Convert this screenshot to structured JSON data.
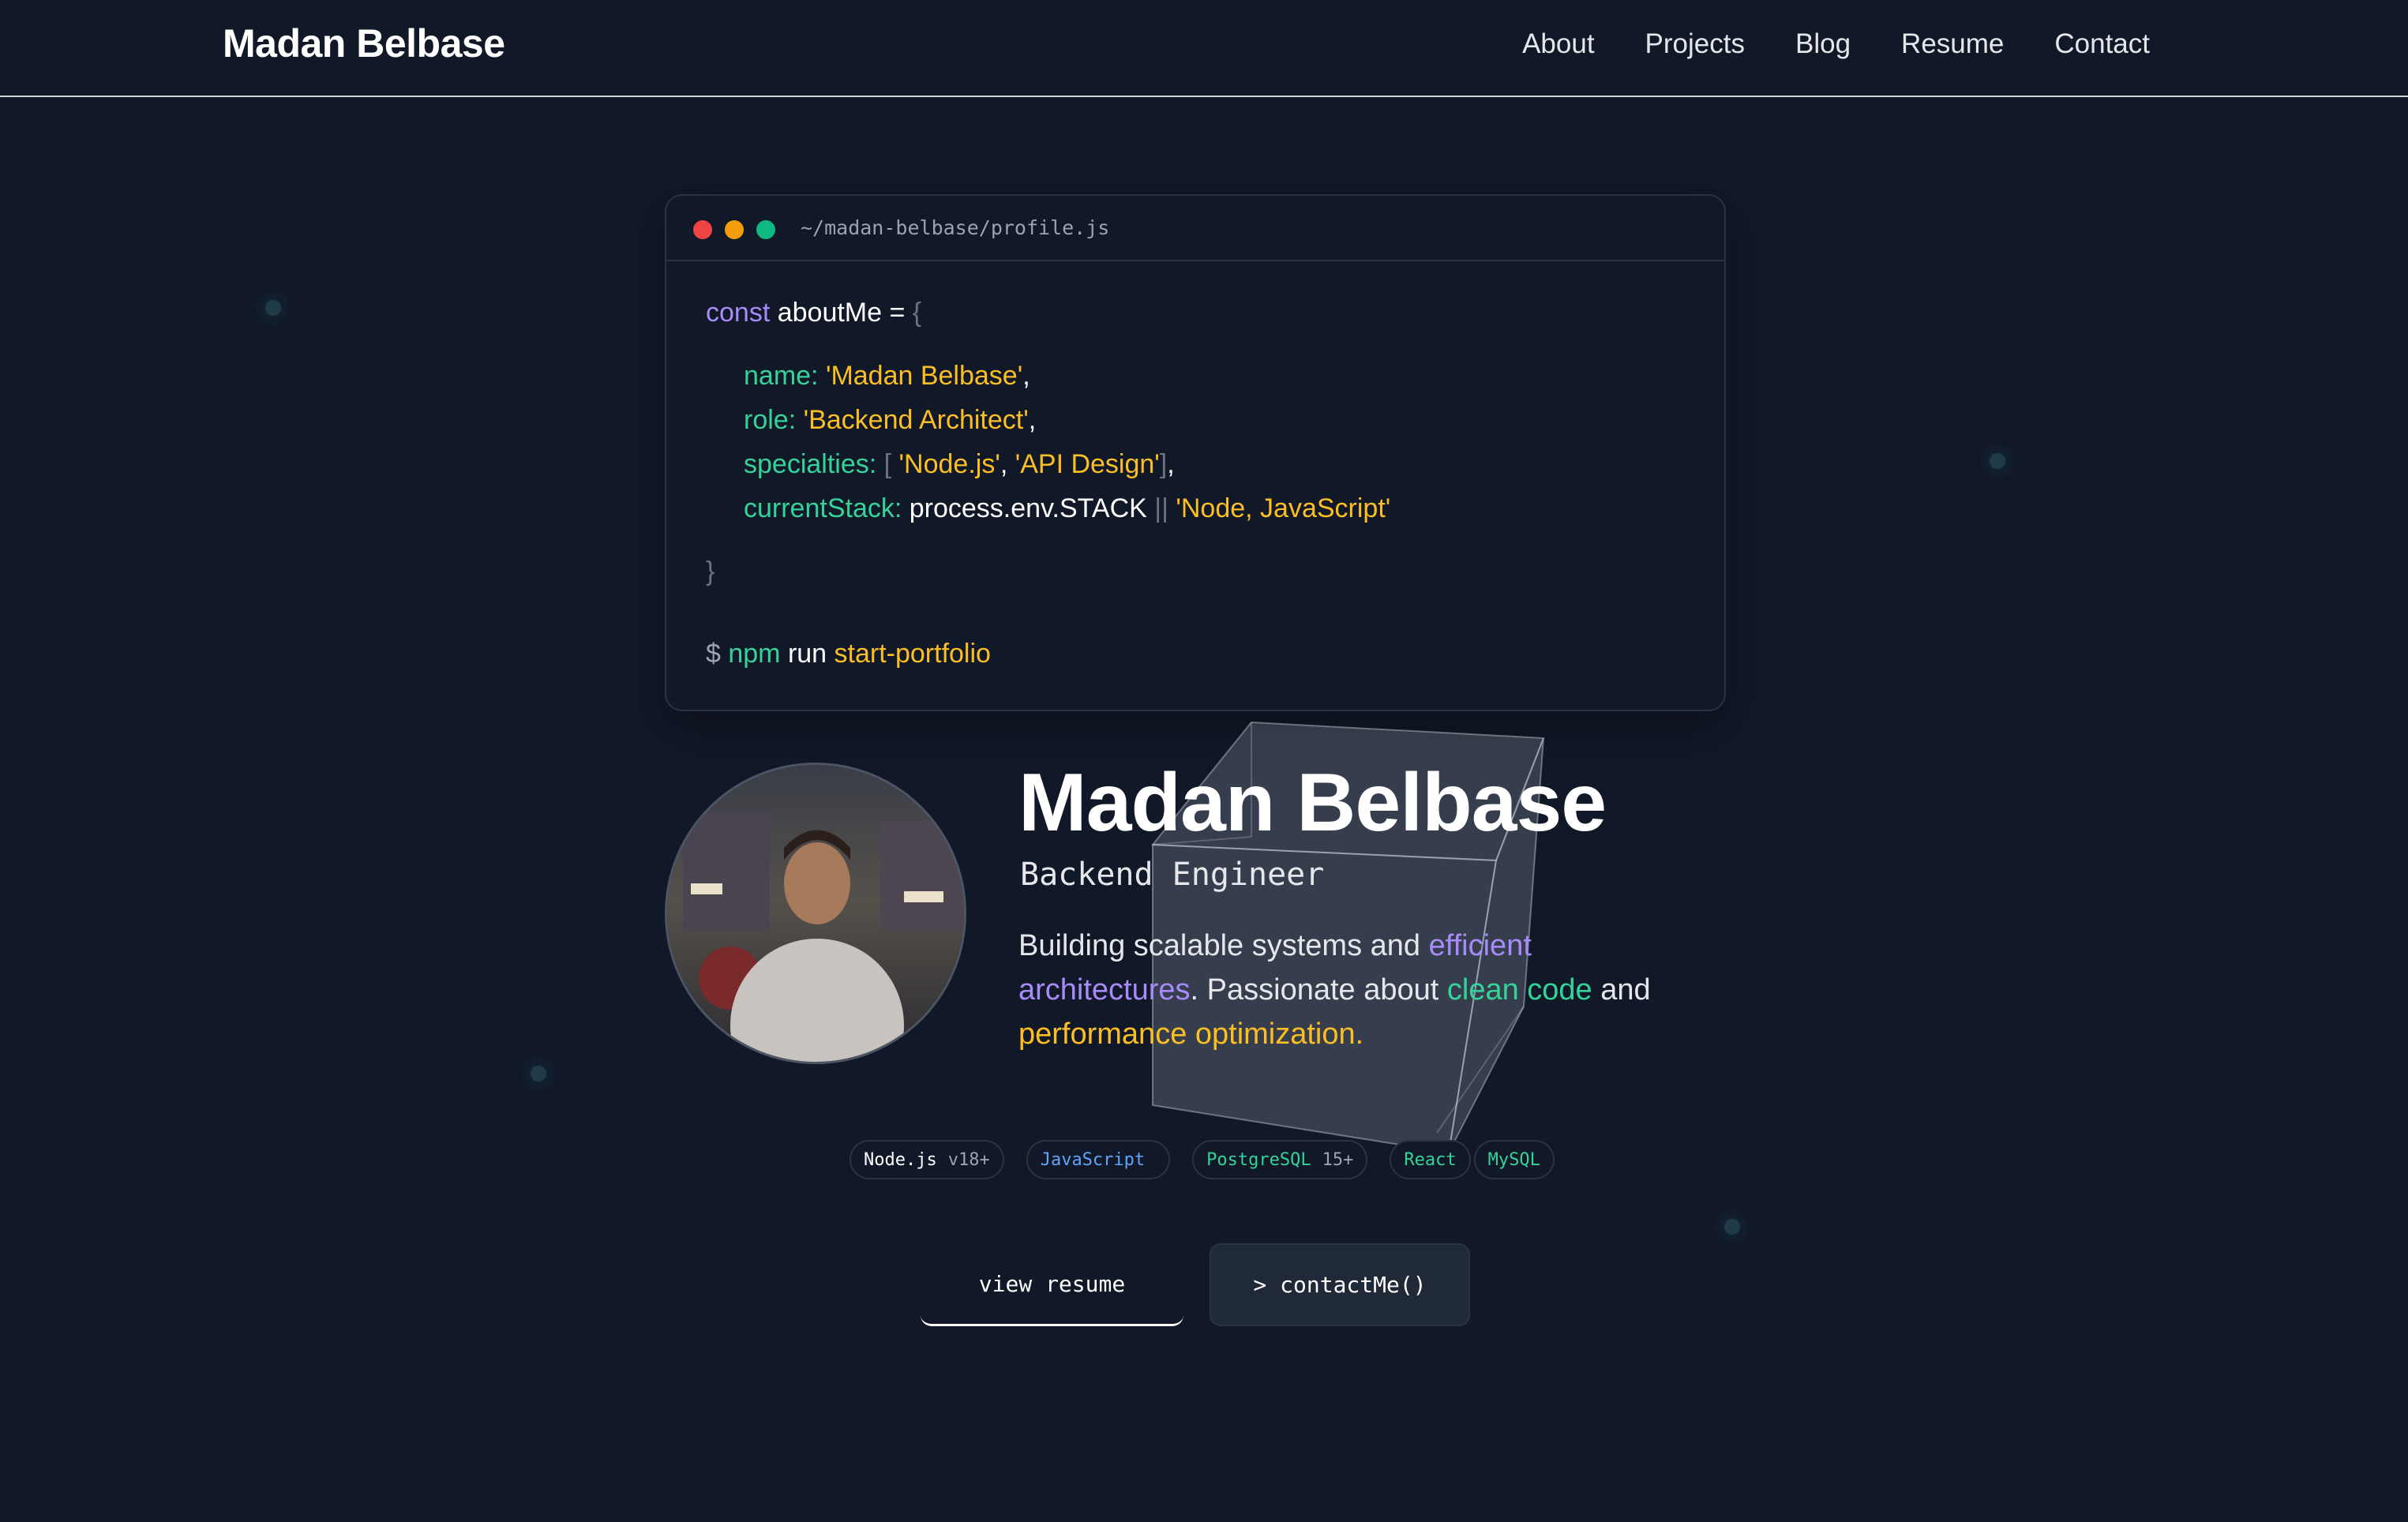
{
  "header": {
    "brand": "Madan Belbase",
    "nav": [
      "About",
      "Projects",
      "Blog",
      "Resume",
      "Contact"
    ]
  },
  "code_window": {
    "path": "~/madan-belbase/profile.js",
    "decl_kw": "const",
    "decl_name": "aboutMe",
    "decl_eq": " = ",
    "open_brace": "{",
    "name_key": "name: ",
    "name_val": "'Madan Belbase'",
    "role_key": "role: ",
    "role_val": "'Backend Architect'",
    "spec_key": "specialties: ",
    "spec_val1": "'Node.js'",
    "spec_val2": "'API Design'",
    "stack_key": "currentStack: ",
    "stack_expr": "process.env.STACK",
    "stack_or": " || ",
    "stack_val": "'Node, JavaScript'",
    "close_brace": "}",
    "cmd_prompt": "$ ",
    "cmd_npm": "npm",
    "cmd_run": " run ",
    "cmd_script": "start-portfolio"
  },
  "profile": {
    "name": "Madan Belbase",
    "role": "Backend Engineer",
    "bio_1": "Building scalable systems and ",
    "bio_hl1": "efficient architectures",
    "bio_2": ". Passionate about ",
    "bio_hl2": "clean code",
    "bio_3": " and ",
    "bio_hl3": "performance optimization."
  },
  "tags": [
    {
      "name": "Node.js",
      "version": "v18+"
    },
    {
      "name": "JavaScript",
      "version": ""
    },
    {
      "name": "PostgreSQL",
      "version": "15+"
    },
    {
      "name": "React",
      "version": ""
    },
    {
      "name": "MySQL",
      "version": ""
    }
  ],
  "buttons": {
    "resume": "view resume",
    "contact": "> contactMe()"
  },
  "colors": {
    "background": "#111827",
    "keyword": "#a78bfa",
    "property": "#34d399",
    "string": "#fbbf24"
  }
}
